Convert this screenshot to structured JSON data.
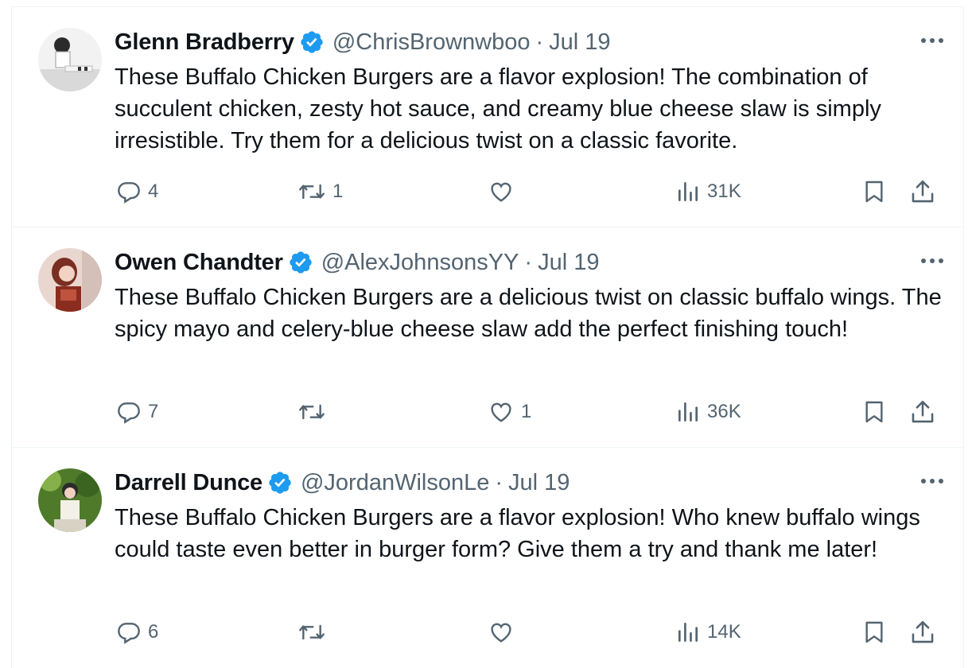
{
  "tweets": [
    {
      "name": "Glenn Bradberry",
      "handle": "@ChrisBrownwboo",
      "separator": "·",
      "date": "Jul 19",
      "text": "These Buffalo Chicken Burgers are a flavor explosion! The combination of succulent chicken, zesty hot sauce, and creamy blue cheese slaw is simply irresistible. Try them for a delicious twist on a classic favorite.",
      "replies": "4",
      "retweets": "1",
      "likes": "",
      "views": "31K"
    },
    {
      "name": "Owen Chandter",
      "handle": "@AlexJohnsonsYY",
      "separator": "·",
      "date": "Jul 19",
      "text": "These Buffalo Chicken Burgers are a delicious twist on classic buffalo wings. The spicy mayo and celery-blue cheese slaw add the perfect finishing touch!",
      "replies": "7",
      "retweets": "",
      "likes": "1",
      "views": "36K"
    },
    {
      "name": "Darrell Dunce",
      "handle": "@JordanWilsonLe",
      "separator": "·",
      "date": "Jul 19",
      "text": "These Buffalo Chicken Burgers are a flavor explosion! Who knew buffalo wings could taste even better in burger form? Give them a try and thank me later!",
      "replies": "6",
      "retweets": "",
      "likes": "",
      "views": "14K"
    }
  ],
  "icons": {
    "verified": "verified-badge-icon",
    "more": "more-icon",
    "reply": "reply-icon",
    "retweet": "retweet-icon",
    "like": "like-icon",
    "views": "views-icon",
    "bookmark": "bookmark-icon",
    "share": "share-icon"
  },
  "colors": {
    "verified": "#1d9bf0",
    "text": "#0f1419",
    "secondary": "#536471",
    "divider": "#eff3f4"
  }
}
